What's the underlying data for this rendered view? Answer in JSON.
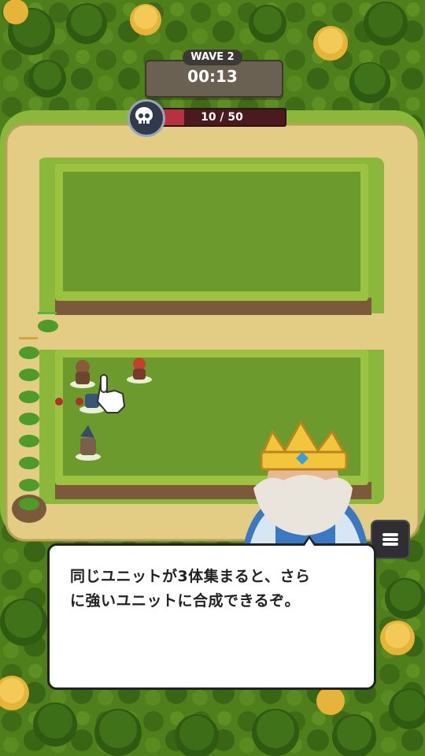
{
  "hud": {
    "wave_label": "WAVE 2",
    "timer": "00:13",
    "kill_count": "10 / 50",
    "kill_progress": 0.2
  },
  "dialog": {
    "message": "同じユニットが3体集まると、さら\nに強いユニットに合成できるぞ。"
  },
  "icons": {
    "skull": "skull-icon",
    "menu": "menu-icon",
    "tap_hand": "tap-hand-icon"
  },
  "colors": {
    "kill_bar_fill": "#b7323e",
    "kill_bar_bg": "#4a1a1f",
    "grass": "#5f8f22",
    "path": "#e3cd85"
  }
}
